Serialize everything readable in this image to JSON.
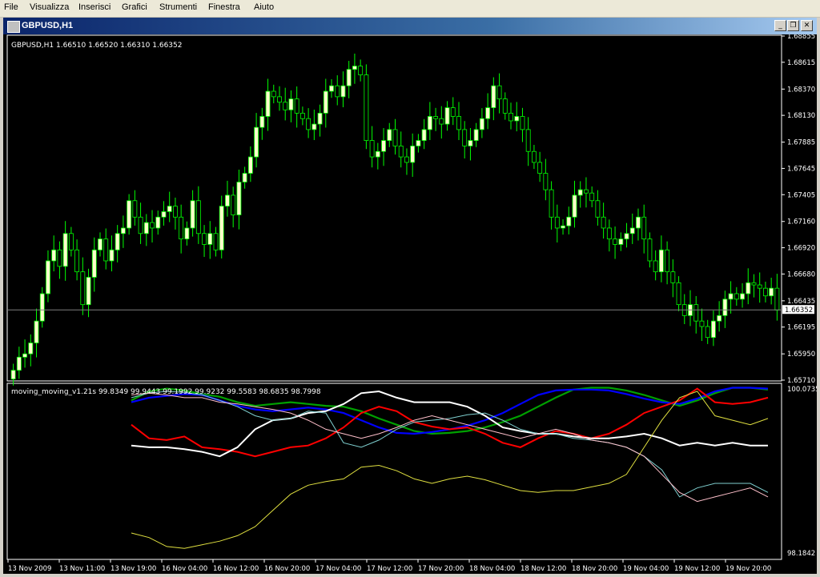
{
  "menu": [
    "File",
    "Visualizza",
    "Inserisci",
    "Grafici",
    "Strumenti",
    "Finestra",
    "Aiuto"
  ],
  "window": {
    "title": "GBPUSD,H1",
    "controls": {
      "minimize": "_",
      "restore": "❐",
      "close": "✕"
    }
  },
  "colors": {
    "bull": "#ffffcc",
    "bear": "#000000",
    "wick": "#00ff00",
    "axis": "#ffffff",
    "bid_line": "#7f7f7f",
    "series_green": "#00a000",
    "series_blue": "#0000ff",
    "series_red": "#ff0000",
    "series_white": "#ffffff",
    "series_cyan": "#7fd0d0",
    "series_pink": "#ffc0cb",
    "series_yellow": "#e0e040"
  },
  "chart_data": [
    {
      "type": "candlestick",
      "title": "GBPUSD,H1  1.66510 1.66520 1.66310 1.66352",
      "ylim": [
        1.6571,
        1.68855
      ],
      "y_ticks": [
        "1.68855",
        "1.68615",
        "1.68370",
        "1.68130",
        "1.67885",
        "1.67645",
        "1.67405",
        "1.67160",
        "1.66920",
        "1.66680",
        "1.66435",
        "1.66195",
        "1.65950",
        "1.65710"
      ],
      "current_price": "1.66352",
      "x_ticks": [
        "13 Nov 2009",
        "13 Nov 11:00",
        "13 Nov 19:00",
        "16 Nov 04:00",
        "16 Nov 12:00",
        "16 Nov 20:00",
        "17 Nov 04:00",
        "17 Nov 12:00",
        "17 Nov 20:00",
        "18 Nov 04:00",
        "18 Nov 12:00",
        "18 Nov 20:00",
        "19 Nov 04:00",
        "19 Nov 12:00",
        "19 Nov 20:00"
      ],
      "close": [
        1.658,
        1.6592,
        1.6595,
        1.6605,
        1.6625,
        1.665,
        1.668,
        1.669,
        1.6675,
        1.6705,
        1.669,
        1.667,
        1.664,
        1.6665,
        1.669,
        1.67,
        1.668,
        1.669,
        1.6705,
        1.671,
        1.6735,
        1.672,
        1.6705,
        1.6715,
        1.671,
        1.672,
        1.6725,
        1.673,
        1.672,
        1.67,
        1.671,
        1.6735,
        1.6705,
        1.6695,
        1.6705,
        1.669,
        1.673,
        1.674,
        1.6722,
        1.6752,
        1.676,
        1.6775,
        1.6802,
        1.6812,
        1.6835,
        1.683,
        1.6825,
        1.6818,
        1.6828,
        1.6815,
        1.681,
        1.68,
        1.6805,
        1.6815,
        1.6835,
        1.684,
        1.683,
        1.684,
        1.6855,
        1.6858,
        1.685,
        1.679,
        1.6775,
        1.678,
        1.679,
        1.68,
        1.6785,
        1.6775,
        1.677,
        1.6785,
        1.679,
        1.68,
        1.6812,
        1.681,
        1.6805,
        1.682,
        1.6812,
        1.68,
        1.6785,
        1.679,
        1.68,
        1.681,
        1.682,
        1.684,
        1.6828,
        1.6815,
        1.6808,
        1.6812,
        1.68,
        1.678,
        1.677,
        1.676,
        1.6745,
        1.672,
        1.671,
        1.6712,
        1.672,
        1.674,
        1.6745,
        1.6742,
        1.6735,
        1.672,
        1.671,
        1.67,
        1.6695,
        1.67,
        1.6705,
        1.671,
        1.672,
        1.67,
        1.668,
        1.667,
        1.669,
        1.667,
        1.666,
        1.664,
        1.663,
        1.664,
        1.6625,
        1.662,
        1.661,
        1.6625,
        1.663,
        1.6645,
        1.665,
        1.6645,
        1.665,
        1.666,
        1.6658,
        1.6655,
        1.6648,
        1.6655,
        1.6635
      ],
      "series": [
        {
          "name": "moving_moving_v1.21s",
          "values": [
            99.8349,
            99.9443,
            99.1992,
            99.9232,
            99.5583,
            98.6835,
            98.7998
          ]
        }
      ]
    },
    {
      "type": "line",
      "title": "moving_moving_v1.21s 99.8349 99.9443 99.1992 99.9232 99.5583 98.6835 98.7998",
      "ylim": [
        98.1842,
        100.0735
      ],
      "y_ticks": [
        "100.0735",
        "98.1842"
      ],
      "series": [
        {
          "name": "green",
          "color": "#00a000",
          "values": [
            99.92,
            100.02,
            100.05,
            100.03,
            99.99,
            99.96,
            99.9,
            99.86,
            99.88,
            99.9,
            99.88,
            99.86,
            99.85,
            99.8,
            99.72,
            99.65,
            99.58,
            99.55,
            99.56,
            99.58,
            99.62,
            99.68,
            99.75,
            99.85,
            99.95,
            100.04,
            100.06,
            100.06,
            100.03,
            99.98,
            99.92,
            99.86,
            99.92,
            100.0,
            100.06,
            100.06,
            100.04
          ]
        },
        {
          "name": "blue",
          "color": "#0000ff",
          "values": [
            99.9,
            99.95,
            99.97,
            99.99,
            99.98,
            99.92,
            99.86,
            99.82,
            99.8,
            99.82,
            99.84,
            99.82,
            99.78,
            99.7,
            99.62,
            99.56,
            99.55,
            99.57,
            99.6,
            99.64,
            99.7,
            99.78,
            99.88,
            99.98,
            100.03,
            100.04,
            100.04,
            100.03,
            99.99,
            99.94,
            99.9,
            99.88,
            99.94,
            100.02,
            100.06,
            100.06,
            100.05
          ]
        },
        {
          "name": "red",
          "color": "#ff0000",
          "values": [
            99.65,
            99.5,
            99.48,
            99.52,
            99.4,
            99.38,
            99.35,
            99.3,
            99.35,
            99.4,
            99.42,
            99.5,
            99.62,
            99.78,
            99.85,
            99.8,
            99.68,
            99.63,
            99.6,
            99.62,
            99.55,
            99.45,
            99.4,
            99.5,
            99.58,
            99.55,
            99.5,
            99.55,
            99.65,
            99.78,
            99.85,
            99.92,
            100.05,
            99.9,
            99.88,
            99.9,
            99.95
          ]
        },
        {
          "name": "white",
          "color": "#ffffff",
          "values": [
            99.42,
            99.4,
            99.4,
            99.38,
            99.35,
            99.3,
            99.4,
            99.6,
            99.7,
            99.72,
            99.78,
            99.8,
            99.88,
            100.0,
            100.02,
            99.95,
            99.9,
            99.9,
            99.9,
            99.85,
            99.75,
            99.62,
            99.58,
            99.55,
            99.55,
            99.52,
            99.5,
            99.5,
            99.52,
            99.55,
            99.5,
            99.42,
            99.45,
            99.42,
            99.45,
            99.42,
            99.42
          ]
        },
        {
          "name": "cyan",
          "color": "#7fd0d0",
          "values": [
            99.95,
            100.0,
            100.02,
            100.01,
            99.98,
            99.92,
            99.85,
            99.75,
            99.7,
            99.72,
            99.8,
            99.78,
            99.45,
            99.4,
            99.48,
            99.6,
            99.68,
            99.7,
            99.72,
            99.76,
            99.78,
            99.7,
            99.6,
            99.55,
            99.55,
            99.5,
            99.48,
            99.45,
            99.4,
            99.3,
            99.15,
            98.85,
            98.95,
            99.0,
            99.0,
            99.0,
            98.9
          ]
        },
        {
          "name": "pink",
          "color": "#ffc0cb",
          "values": [
            99.98,
            100.0,
            99.98,
            99.95,
            99.95,
            99.9,
            99.88,
            99.85,
            99.82,
            99.78,
            99.7,
            99.6,
            99.55,
            99.5,
            99.55,
            99.62,
            99.7,
            99.75,
            99.7,
            99.65,
            99.6,
            99.55,
            99.5,
            99.55,
            99.6,
            99.55,
            99.48,
            99.45,
            99.4,
            99.3,
            99.1,
            98.9,
            98.8,
            98.85,
            98.9,
            98.95,
            98.85
          ]
        },
        {
          "name": "yellow",
          "color": "#e0e040",
          "values": [
            98.45,
            98.4,
            98.3,
            98.28,
            98.32,
            98.36,
            98.42,
            98.52,
            98.7,
            98.88,
            98.98,
            99.02,
            99.05,
            99.18,
            99.2,
            99.14,
            99.05,
            99.0,
            99.05,
            99.08,
            99.04,
            98.98,
            98.92,
            98.9,
            98.92,
            98.92,
            98.96,
            99.0,
            99.1,
            99.4,
            99.7,
            99.95,
            100.02,
            99.75,
            99.7,
            99.65,
            99.72
          ]
        }
      ]
    }
  ]
}
